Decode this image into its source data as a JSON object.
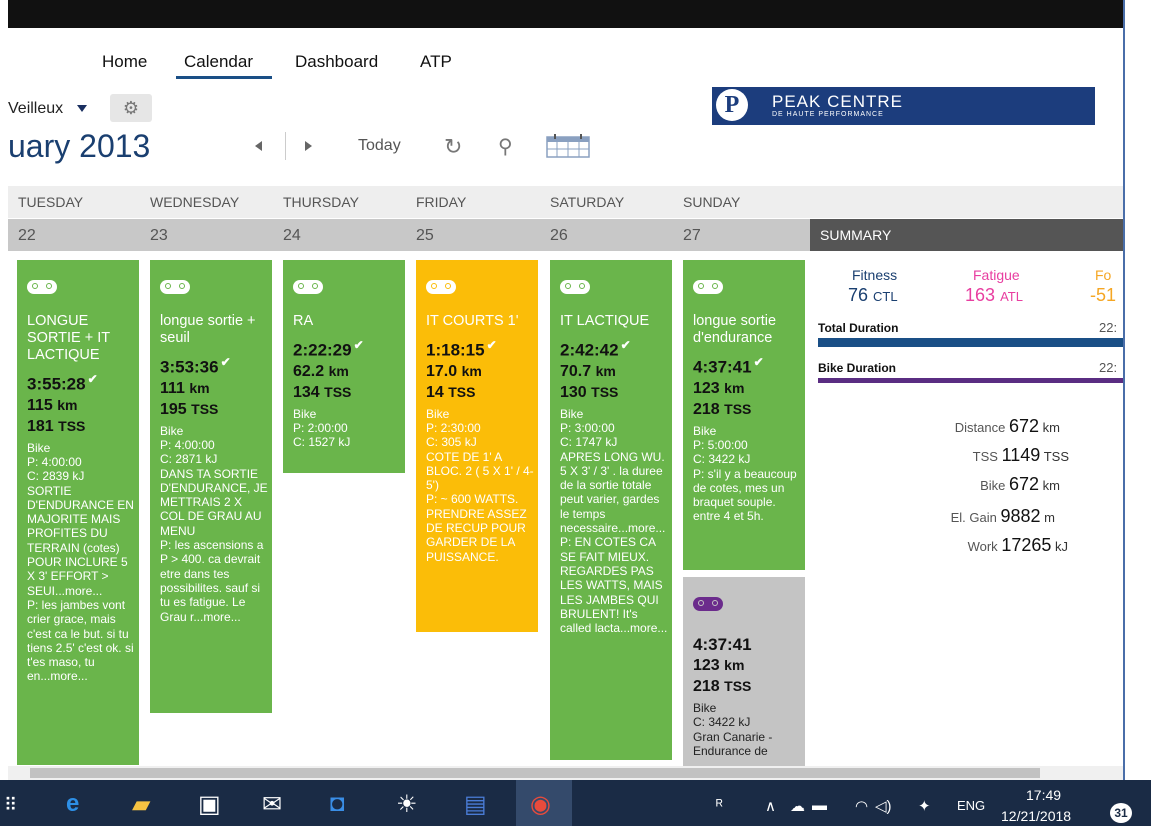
{
  "nav": {
    "home": "Home",
    "calendar": "Calendar",
    "dashboard": "Dashboard",
    "atp": "ATP"
  },
  "toolbar": {
    "athlete": "Veilleux",
    "month_title": "uary 2013",
    "today": "Today"
  },
  "logo": {
    "name": "PEAK CENTRE",
    "subtitle": "DE HAUTE PERFORMANCE"
  },
  "week": {
    "days": [
      "TUESDAY",
      "WEDNESDAY",
      "THURSDAY",
      "FRIDAY",
      "SATURDAY",
      "SUNDAY"
    ],
    "dates": [
      "22",
      "23",
      "24",
      "25",
      "26",
      "27"
    ]
  },
  "workouts": {
    "tue": {
      "title": "LONGUE SORTIE + IT LACTIQUE",
      "duration": "3:55:28",
      "distance": "115",
      "distance_unit": "km",
      "tss": "181",
      "tss_unit": "TSS",
      "sport": "Bike",
      "planned": "P: 4:00:00",
      "completed": "C: 2839 kJ",
      "note": "SORTIE D'ENDURANCE EN MAJORITE MAIS PROFITES DU TERRAIN (cotes) POUR INCLURE 5 X 3' EFFORT > SEUI...more...",
      "post": "P: les jambes vont crier grace, mais c'est ca le but. si tu tiens 2.5' c'est ok. si t'es maso, tu en...more..."
    },
    "wed": {
      "title": "longue sortie + seuil",
      "duration": "3:53:36",
      "distance": "111",
      "distance_unit": "km",
      "tss": "195",
      "tss_unit": "TSS",
      "sport": "Bike",
      "planned": "P: 4:00:00",
      "completed": "C: 2871 kJ",
      "note": "DANS TA SORTIE D'ENDURANCE, JE METTRAIS 2 X COL DE GRAU AU MENU",
      "post": "P: les ascensions a P > 400. ca devrait etre dans tes possibilites. sauf si tu es fatigue. Le Grau r...more..."
    },
    "thu": {
      "title": "RA",
      "duration": "2:22:29",
      "distance": "62.2",
      "distance_unit": "km",
      "tss": "134",
      "tss_unit": "TSS",
      "sport": "Bike",
      "planned": "P: 2:00:00",
      "completed": "C: 1527 kJ"
    },
    "fri": {
      "title": "IT COURTS 1'",
      "duration": "1:18:15",
      "distance": "17.0",
      "distance_unit": "km",
      "tss": "14",
      "tss_unit": "TSS",
      "sport": "Bike",
      "planned": "P: 2:30:00",
      "completed": "C: 305 kJ",
      "note": "COTE DE 1' A BLOC. 2 ( 5 X 1' / 4-5')",
      "post": "P: ~ 600 WATTS. PRENDRE ASSEZ DE RECUP POUR GARDER DE LA PUISSANCE."
    },
    "sat": {
      "title": "IT LACTIQUE",
      "duration": "2:42:42",
      "distance": "70.7",
      "distance_unit": "km",
      "tss": "130",
      "tss_unit": "TSS",
      "sport": "Bike",
      "planned": "P: 3:00:00",
      "completed": "C: 1747 kJ",
      "note": "APRES LONG WU. 5 X 3' / 3' . la duree de la sortie totale peut varier, gardes le temps necessaire...more...",
      "post": "P: EN COTES CA SE FAIT MIEUX. REGARDES PAS LES WATTS, MAIS LES JAMBES QUI BRULENT! It's called lacta...more..."
    },
    "sun": {
      "title": "longue sortie d'endurance",
      "duration": "4:37:41",
      "distance": "123",
      "distance_unit": "km",
      "tss": "218",
      "tss_unit": "TSS",
      "sport": "Bike",
      "planned": "P: 5:00:00",
      "completed": "C: 3422 kJ",
      "note": "P: s'il y a beaucoup de cotes, mes un braquet souple. entre 4 et 5h."
    },
    "sun2": {
      "duration": "4:37:41",
      "distance": "123",
      "distance_unit": "km",
      "tss": "218",
      "tss_unit": "TSS",
      "sport": "Bike",
      "completed": "C: 3422 kJ",
      "note": "Gran Canarie - Endurance de"
    }
  },
  "summary": {
    "header": "SUMMARY",
    "fitness_label": "Fitness",
    "fitness_value": "76",
    "fitness_unit": "CTL",
    "fatigue_label": "Fatigue",
    "fatigue_value": "163",
    "fatigue_unit": "ATL",
    "form_label": "Fo",
    "form_value": "-51",
    "total_duration_label": "Total Duration",
    "total_duration_value": "22:",
    "bike_duration_label": "Bike Duration",
    "bike_duration_value": "22:",
    "distance_label": "Distance",
    "distance_value": "672",
    "distance_unit": "km",
    "tss_label": "TSS",
    "tss_value": "1149",
    "tss_unit": "TSS",
    "bike_label": "Bike",
    "bike_value": "672",
    "bike_unit": "km",
    "elev_label": "El. Gain",
    "elev_value": "9882",
    "elev_unit": "m",
    "work_label": "Work",
    "work_value": "17265",
    "work_unit": "kJ"
  },
  "colors": {
    "fitness": "#1a3f70",
    "fatigue": "#e83ea0",
    "form": "#f5a623",
    "total_bar": "#1a4f86",
    "bike_bar": "#5a2d82",
    "completed": "#6ab54b",
    "planned": "#fbbd08"
  },
  "taskbar": {
    "lang": "ENG",
    "time": "17:49",
    "date": "12/21/2018",
    "notifications": "31"
  }
}
